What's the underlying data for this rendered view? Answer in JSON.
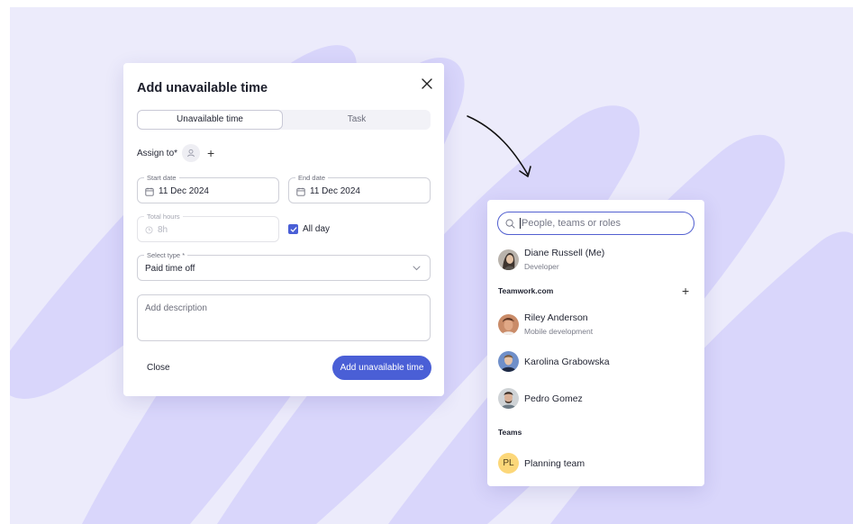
{
  "modal": {
    "title": "Add unavailable time",
    "tabs": [
      {
        "label": "Unavailable time",
        "active": true
      },
      {
        "label": "Task",
        "active": false
      }
    ],
    "assign_label": "Assign to*",
    "start_date": {
      "label": "Start date",
      "value": "11 Dec 2024"
    },
    "end_date": {
      "label": "End date",
      "value": "11 Dec 2024"
    },
    "total_hours": {
      "label": "Total hours",
      "value": "8h"
    },
    "all_day": {
      "label": "All day",
      "checked": true
    },
    "select_type": {
      "label": "Select type *",
      "value": "Paid time off"
    },
    "description_placeholder": "Add description",
    "close_label": "Close",
    "submit_label": "Add unavailable time"
  },
  "picker": {
    "search_placeholder": "People, teams or roles",
    "me": {
      "name": "Diane Russell (Me)",
      "role": "Developer"
    },
    "group_title": "Teamwork.com",
    "people": [
      {
        "name": "Riley Anderson",
        "role": "Mobile development"
      },
      {
        "name": "Karolina Grabowska",
        "role": ""
      },
      {
        "name": "Pedro Gomez",
        "role": ""
      }
    ],
    "teams_title": "Teams",
    "teams": [
      {
        "initials": "PL",
        "name": "Planning team"
      }
    ]
  },
  "colors": {
    "accent": "#4a5fd6",
    "background": "#ecebfb",
    "shapes": "#d9d6fb",
    "team_avatar": "#fcd779"
  }
}
